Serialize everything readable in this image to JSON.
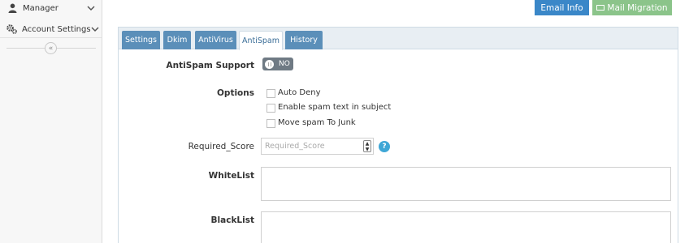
{
  "sidebar": {
    "items": [
      {
        "label": "Manager",
        "icon": "user-icon"
      },
      {
        "label": "Account Settings",
        "icon": "gears-icon"
      }
    ],
    "collapse_glyph": "«"
  },
  "header": {
    "email_info_label": "Email Info",
    "mail_migration_label": "Mail Migration"
  },
  "tabs": [
    {
      "label": "Settings",
      "active": false
    },
    {
      "label": "Dkim",
      "active": false
    },
    {
      "label": "AntiVirus",
      "active": false
    },
    {
      "label": "AntiSpam",
      "active": true
    },
    {
      "label": "History",
      "active": false
    }
  ],
  "form": {
    "antispam_support_label": "AntiSpam Support",
    "antispam_toggle_text": "NO",
    "options_label": "Options",
    "options": [
      {
        "label": "Auto Deny",
        "checked": false
      },
      {
        "label": "Enable spam text in subject",
        "checked": false
      },
      {
        "label": "Move spam To Junk",
        "checked": false
      }
    ],
    "required_score_label": "Required_Score",
    "required_score_placeholder": "Required_Score",
    "required_score_value": "",
    "help_glyph": "?",
    "whitelist_label": "WhiteList",
    "whitelist_value": "",
    "blacklist_label": "BlackList",
    "blacklist_value": ""
  },
  "colors": {
    "primary": "#3a87c8",
    "success": "#8bc48a",
    "tab": "#5b8fb9",
    "toggle": "#6f7a84",
    "help": "#3fa7d6"
  }
}
